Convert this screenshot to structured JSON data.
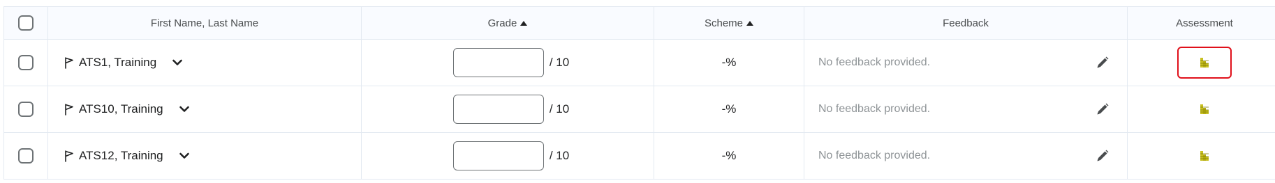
{
  "table": {
    "headers": {
      "name": "First Name, Last Name",
      "grade": "Grade",
      "scheme": "Scheme",
      "feedback": "Feedback",
      "assessment": "Assessment"
    },
    "rows": [
      {
        "name": "ATS1, Training",
        "grade_value": "",
        "grade_max": "/ 10",
        "scheme": "-%",
        "feedback": "No feedback provided.",
        "assessment_highlighted": true
      },
      {
        "name": "ATS10, Training",
        "grade_value": "",
        "grade_max": "/ 10",
        "scheme": "-%",
        "feedback": "No feedback provided.",
        "assessment_highlighted": false
      },
      {
        "name": "ATS12, Training",
        "grade_value": "",
        "grade_max": "/ 10",
        "scheme": "-%",
        "feedback": "No feedback provided.",
        "assessment_highlighted": false
      }
    ]
  },
  "icons": {
    "flag": "flag-icon",
    "chevron": "chevron-down-icon",
    "pencil": "pencil-icon",
    "rubric": "rubric-icon",
    "sort": "sort-ascending-icon"
  },
  "colors": {
    "highlight_border": "#e0101a",
    "rubric_icon": "#c8c020",
    "border": "#e3e9f1",
    "header_bg": "#f9fbff",
    "muted_text": "#8f9497"
  }
}
